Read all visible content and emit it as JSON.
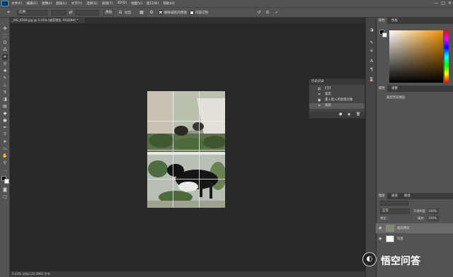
{
  "app": {
    "logo": "Ps",
    "menu": [
      "文件(F)",
      "编辑(E)",
      "图像(I)",
      "图层(L)",
      "文字(Y)",
      "选择(S)",
      "滤镜(T)",
      "3D(D)",
      "视图(V)",
      "窗口(W)",
      "帮助(H)"
    ],
    "window_controls": [
      "—",
      "□",
      "✕"
    ]
  },
  "options": {
    "ratio_value": "比例",
    "clear_label": "清除",
    "straighten_label": "拉直",
    "delete_cropped_label": "删除裁剪的像素",
    "content_aware_label": "内容识别"
  },
  "document": {
    "tab_title": "_MG_6569.jpg @ 5.43% (裁剪预览, RGB/8#) *",
    "status": "5.43%    文档:122.2M/0 字节"
  },
  "history": {
    "title": "历史记录",
    "items": [
      {
        "icon": "open-icon",
        "label": "打开"
      },
      {
        "icon": "crop-icon",
        "label": "裁剪"
      },
      {
        "icon": "smart-object-icon",
        "label": "置入嵌入的智能对象"
      },
      {
        "icon": "crop-icon",
        "label": "裁剪"
      }
    ]
  },
  "panels": {
    "color_tabs": [
      "颜色",
      "色板"
    ],
    "properties_tabs": [
      "属性",
      "调整"
    ],
    "properties_title": "裁剪预览图层",
    "layers_tabs": [
      "图层",
      "通道",
      "路径"
    ],
    "blend_mode": "正常",
    "opacity_label": "不透明度:",
    "opacity_value": "100%",
    "lock_label": "锁定:",
    "fill_label": "填充:",
    "fill_value": "100%",
    "layers": [
      {
        "name": "裁剪预览",
        "selected": true
      },
      {
        "name": "背景",
        "selected": false
      }
    ]
  },
  "watermark": {
    "text": "悟空问答"
  },
  "colors": {
    "accent": "#31a8ff",
    "selected_layer": "#6a6a6a",
    "history_selected": "#5a5a5a"
  }
}
